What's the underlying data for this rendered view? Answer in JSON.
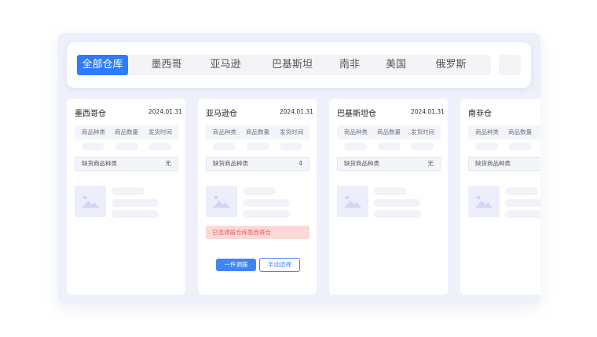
{
  "tabs": [
    {
      "label": "全部仓库",
      "active": true
    },
    {
      "label": "墨西哥"
    },
    {
      "label": "亚马逊"
    },
    {
      "label": "巴基斯坦"
    },
    {
      "label": "南非"
    },
    {
      "label": "美国"
    },
    {
      "label": "俄罗斯"
    }
  ],
  "columns": [
    "商品种类",
    "商品数量",
    "发货时间"
  ],
  "shortage_label": "缺货商品种类",
  "cards": [
    {
      "title": "墨西哥仓",
      "date": "2024.01.31",
      "shortage": "无"
    },
    {
      "title": "亚马逊仓",
      "date": "2024.01.31",
      "shortage": "4",
      "alert": "已选调拨仓库墨西哥仓",
      "primary_button": "一件调拨",
      "secondary_button": "手动选择"
    },
    {
      "title": "巴基斯坦仓",
      "date": "2024.01.31",
      "shortage": "无"
    },
    {
      "title": "南非仓",
      "date": "",
      "shortage": ""
    }
  ],
  "colors": {
    "accent": "#2e7df7",
    "alert_bg": "#fdd8d8",
    "alert_text": "#e06060"
  },
  "icons": {
    "placeholder": "image-icon"
  }
}
